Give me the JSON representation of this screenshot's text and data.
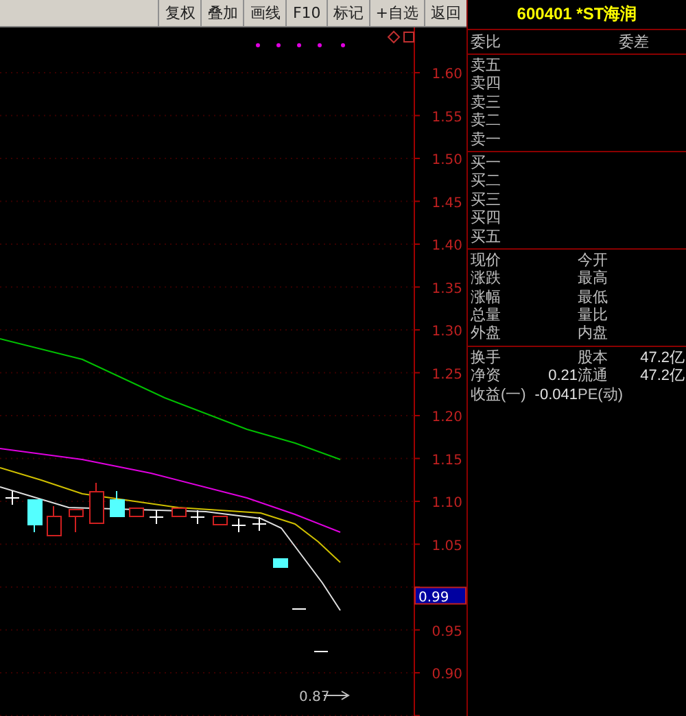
{
  "toolbar": {
    "buttons": [
      "复权",
      "叠加",
      "画线",
      "F10",
      "标记",
      "+自选",
      "返回"
    ]
  },
  "chart": {
    "price_axis": [
      "1.60",
      "1.55",
      "1.50",
      "1.45",
      "1.40",
      "1.35",
      "1.30",
      "1.25",
      "1.20",
      "1.15",
      "1.10",
      "1.05",
      "0.95",
      "0.90"
    ],
    "current_price": "0.99",
    "low_label": "0.87"
  },
  "quote_panel": {
    "title": "600401 *ST海润",
    "order_ratio": {
      "label": "委比",
      "diff_label": "委差"
    },
    "asks": [
      "卖五",
      "卖四",
      "卖三",
      "卖二",
      "卖一"
    ],
    "bids": [
      "买一",
      "买二",
      "买三",
      "买四",
      "买五"
    ],
    "quote_rows": [
      {
        "label": "现价",
        "label2": "今开"
      },
      {
        "label": "涨跌",
        "label2": "最高"
      },
      {
        "label": "涨幅",
        "label2": "最低"
      },
      {
        "label": "总量",
        "label2": "量比"
      },
      {
        "label": "外盘",
        "label2": "内盘"
      }
    ],
    "stats_rows": [
      {
        "label": "换手",
        "label2": "股本",
        "value2": "47.2亿"
      },
      {
        "label": "净资",
        "value": "0.21",
        "label2": "流通",
        "value2": "47.2亿"
      },
      {
        "label": "收益(一)",
        "value": "-0.041",
        "label2": "PE(动)"
      }
    ]
  }
}
